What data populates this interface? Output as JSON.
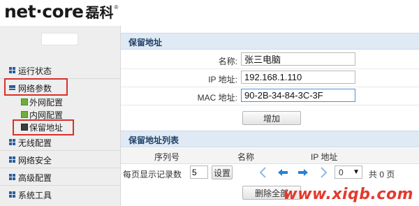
{
  "brand": {
    "name_en": "net·core",
    "name_cn": "磊科",
    "reg": "®"
  },
  "sidebar": {
    "items": [
      {
        "label": "运行状态"
      },
      {
        "label": "网络参数"
      },
      {
        "label": "无线配置"
      },
      {
        "label": "网络安全"
      },
      {
        "label": "高级配置"
      },
      {
        "label": "系统工具"
      }
    ],
    "subitems": [
      {
        "label": "外网配置"
      },
      {
        "label": "内网配置"
      },
      {
        "label": "保留地址"
      }
    ]
  },
  "reserve": {
    "title": "保留地址",
    "name_label": "名称:",
    "name_value": "张三电脑",
    "ip_label": "IP 地址:",
    "ip_value": "192.168.1.110",
    "mac_label": "MAC 地址:",
    "mac_value": "90-2B-34-84-3C-3F",
    "add_button": "增加"
  },
  "list": {
    "title": "保留地址列表",
    "columns": [
      "序列号",
      "名称",
      "IP 地址"
    ],
    "per_page_label": "每页显示记录数",
    "per_page_value": "5",
    "set_button": "设置",
    "page_select": "0",
    "total_text": "共 0 页",
    "delete_all_button": "删除全部"
  },
  "watermark": "www.xiqb.com",
  "colors": {
    "accent_blue": "#2b7fd6",
    "section_bg": "#dfeaf5",
    "highlight_red": "#d9302a",
    "watermark_red": "#e33a2e"
  }
}
